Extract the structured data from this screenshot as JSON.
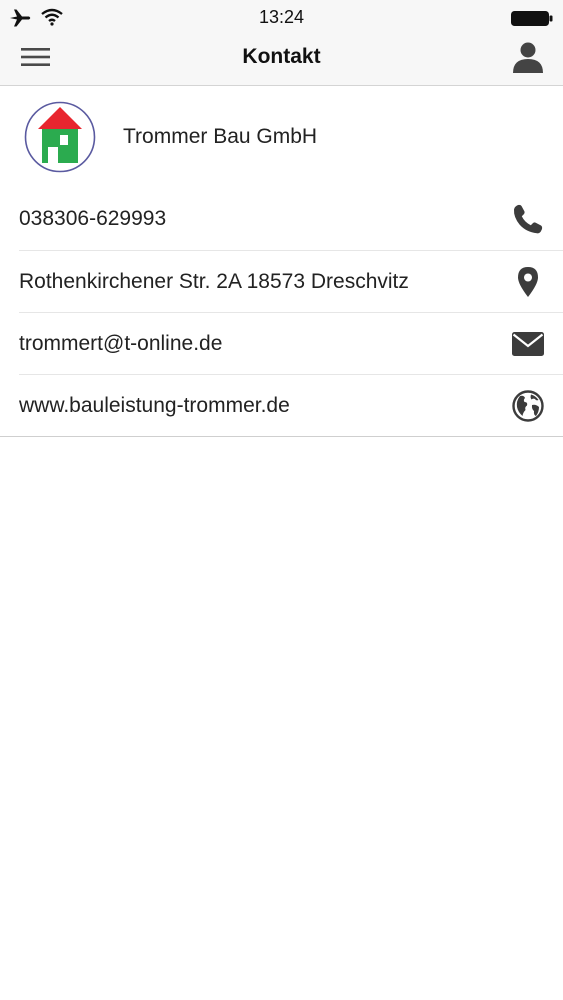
{
  "status_bar": {
    "time": "13:24",
    "icons": [
      "airplane-icon",
      "wifi-icon",
      "battery-icon"
    ]
  },
  "nav": {
    "title": "Kontakt",
    "left_icon": "menu-icon",
    "right_icon": "user-icon"
  },
  "company": {
    "name": "Trommer Bau GmbH",
    "logo_colors": {
      "roof": "#e8262f",
      "house": "#2bab4f",
      "ring": "#5a5aa0"
    }
  },
  "contacts": [
    {
      "id": "phone",
      "text": "038306-629993",
      "icon": "phone-icon"
    },
    {
      "id": "address",
      "text": "Rothenkirchener Str. 2A 18573 Dreschvitz",
      "icon": "location-pin-icon"
    },
    {
      "id": "email",
      "text": "trommert@t-online.de",
      "icon": "mail-icon"
    },
    {
      "id": "website",
      "text": "www.bauleistung-trommer.de",
      "icon": "globe-icon"
    }
  ],
  "colors": {
    "icon": "#3c3c3c",
    "bar": "#f7f7f7",
    "separator": "#e6e6e6"
  }
}
